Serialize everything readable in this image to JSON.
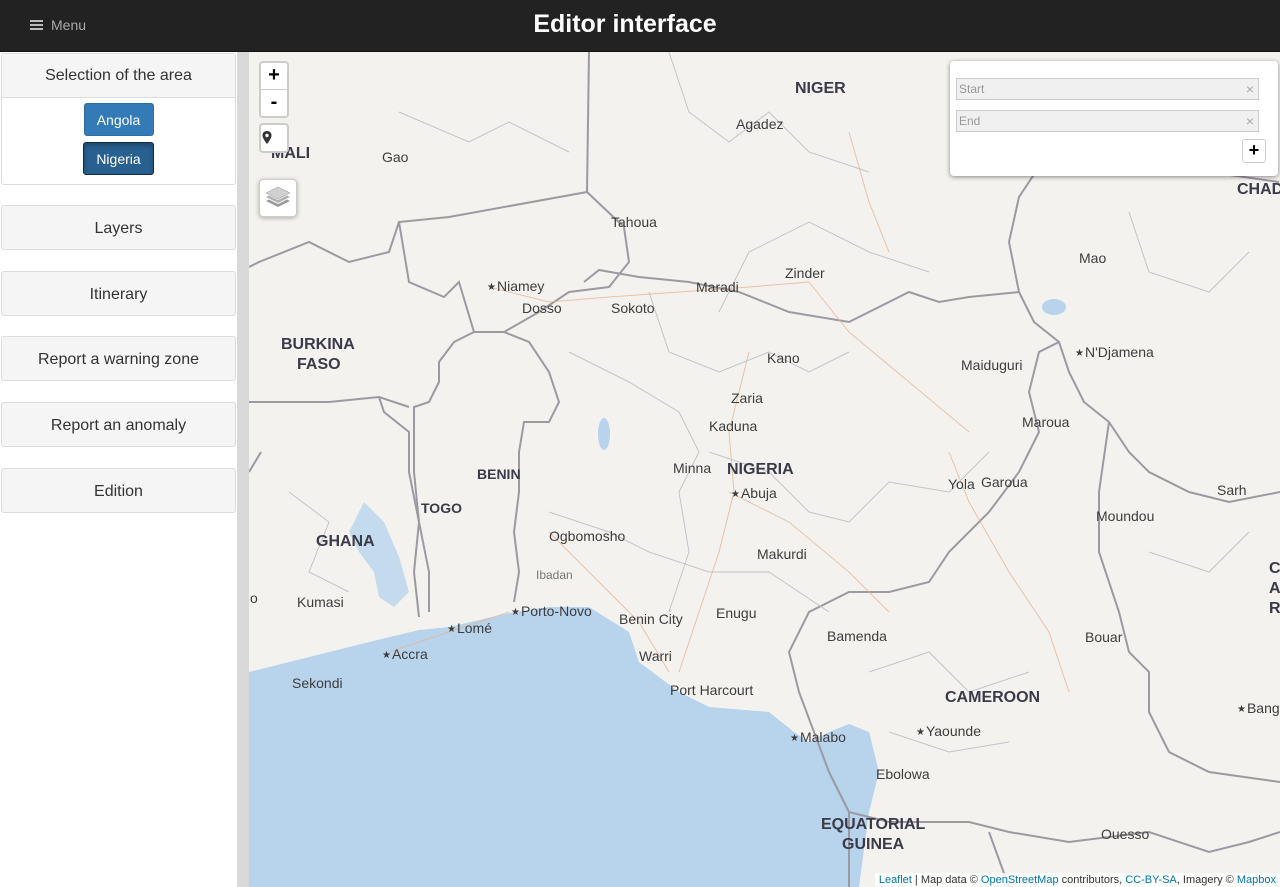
{
  "header": {
    "menu_label": "Menu",
    "title": "Editor interface"
  },
  "sidebar": {
    "area_panel_title": "Selection of the area",
    "area_buttons": [
      "Angola",
      "Nigeria"
    ],
    "active_area": "Nigeria",
    "items": [
      "Layers",
      "Itinerary",
      "Report a warning zone",
      "Report an anomaly",
      "Edition"
    ]
  },
  "map": {
    "zoom_in": "+",
    "zoom_out": "-",
    "routing": {
      "start_placeholder": "Start",
      "end_placeholder": "End",
      "clear_symbol": "×",
      "add_symbol": "+"
    },
    "labels": {
      "niger": "NIGER",
      "mali": "MALI",
      "chad": "CHAD",
      "burkina_faso_1": "BURKINA",
      "burkina_faso_2": "FASO",
      "benin": "BENIN",
      "togo": "TOGO",
      "ghana": "GHANA",
      "nigeria": "NIGERIA",
      "cameroon": "CAMEROON",
      "eq_guinea_1": "EQUATORIAL",
      "eq_guinea_2": "GUINEA",
      "agadez": "Agadez",
      "gao": "Gao",
      "tahoua": "Tahoua",
      "zinder": "Zinder",
      "maradi": "Maradi",
      "mao": "Mao",
      "niamey": "Niamey",
      "dosso": "Dosso",
      "sokoto": "Sokoto",
      "kano": "Kano",
      "ndjamena": "N'Djamena",
      "maiduguri": "Maiduguri",
      "zaria": "Zaria",
      "kaduna": "Kaduna",
      "maroua": "Maroua",
      "minna": "Minna",
      "abuja": "Abuja",
      "yola": "Yola",
      "garoua": "Garoua",
      "sarh": "Sarh",
      "moundou": "Moundou",
      "ogbomosho": "Ogbomosho",
      "ibadan": "Ibadan",
      "makurdi": "Makurdi",
      "kumasi": "Kumasi",
      "porto_novo": "Porto-Novo",
      "benin_city": "Benin City",
      "enugu": "Enugu",
      "bamenda": "Bamenda",
      "bouar": "Bouar",
      "lome": "Lomé",
      "accra": "Accra",
      "warri": "Warri",
      "sekondi": "Sekondi",
      "port_harcourt": "Port Harcourt",
      "yaounde": "Yaounde",
      "malabo": "Malabo",
      "ebolowa": "Ebolowa",
      "ouesso": "Ouesso",
      "bangui_partial": "Bang",
      "car_c": "C",
      "car_a": "A",
      "car_r": "R",
      "edge_o": "o"
    },
    "attribution": {
      "leaflet": "Leaflet",
      "sep1": " | Map data © ",
      "osm": "OpenStreetMap",
      "sep2": " contributors, ",
      "license": "CC-BY-SA",
      "sep3": ", Imagery © ",
      "mapbox": "Mapbox"
    }
  }
}
